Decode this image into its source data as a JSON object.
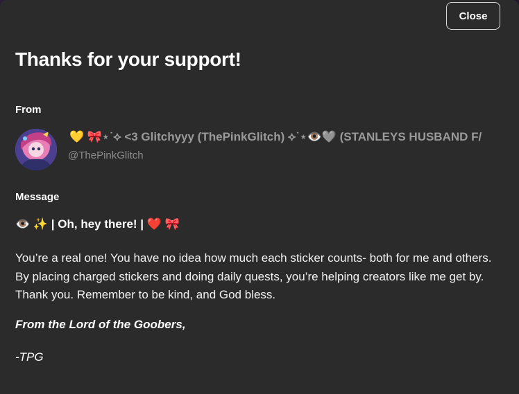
{
  "dialog": {
    "close_label": "Close",
    "title": "Thanks for your support!"
  },
  "from": {
    "label": "From",
    "display_name": "💛 🎀⋆˙⟡ <3 Glitchyyy (ThePinkGlitch) ⟡˙⋆👁️🩶 (STANLEYS HUSBAND F/",
    "handle": "@ThePinkGlitch"
  },
  "message": {
    "label": "Message",
    "heading": "👁️ ✨ | Oh, hey there! | ❤️ 🎀",
    "body": "You’re a real one! You have no idea how much each sticker counts- both for me and others. By placing charged stickers and doing daily quests, you’re helping creators like me get by. Thank you. Remember to be kind, and God bless.",
    "signoff": "From the Lord of the Goobers,",
    "signature": "-TPG"
  },
  "colors": {
    "modal_bg": "#2b2b2b",
    "text_primary": "#ffffff",
    "text_muted": "#9a9a9a"
  }
}
